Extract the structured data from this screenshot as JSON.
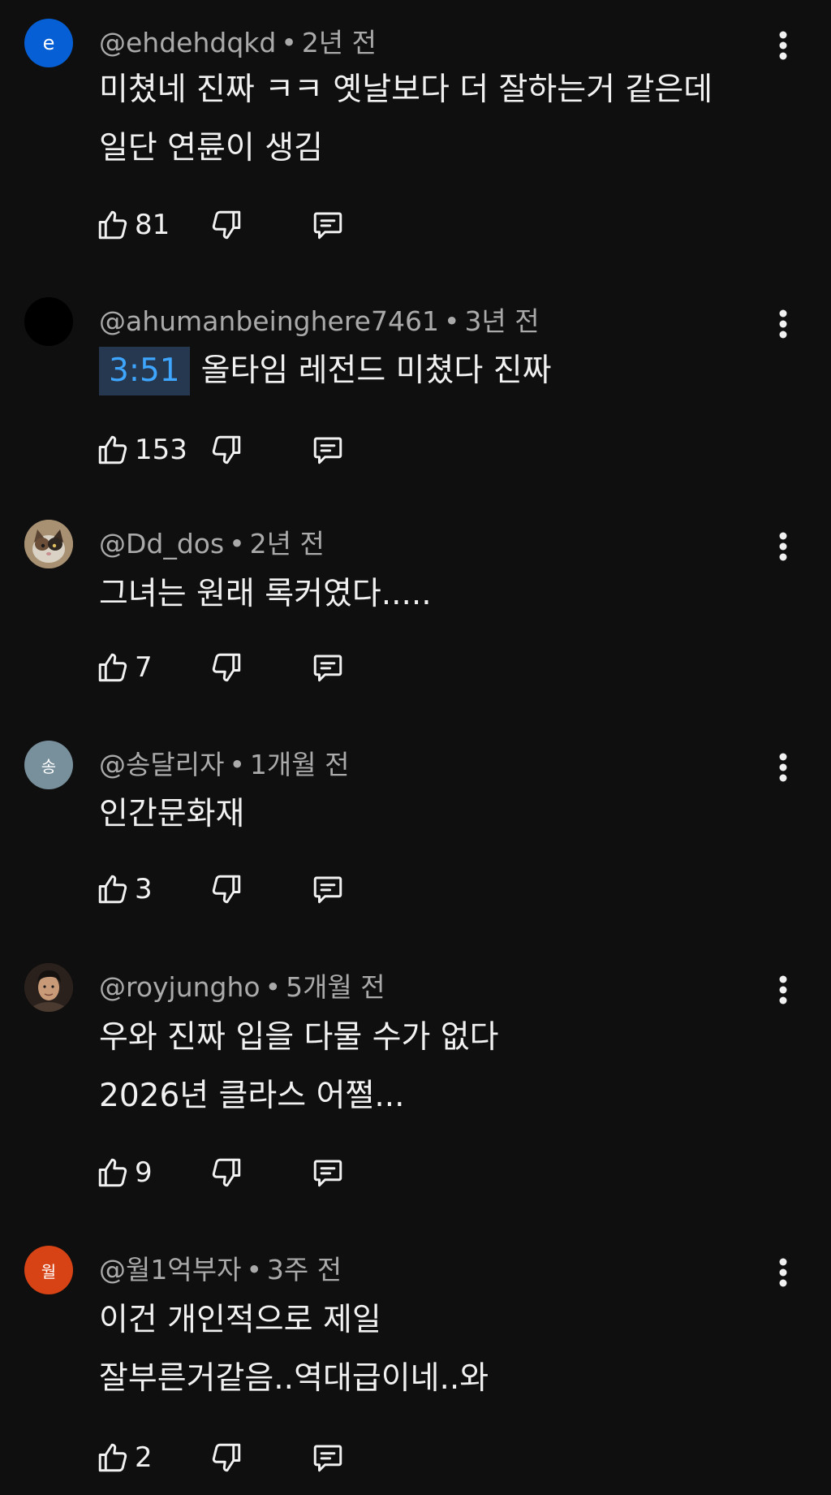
{
  "comments": [
    {
      "avatar": {
        "kind": "letter",
        "letter": "e",
        "color": "#065fd4"
      },
      "author": "@ehdehdqkd",
      "separator": "•",
      "time": "2년 전",
      "timestamp_link": "",
      "lines": [
        "미쳤네 진짜 ㅋㅋ 옛날보다 더 잘하는거 같은데",
        "일단 연륜이 생김"
      ],
      "like_count": "81"
    },
    {
      "avatar": {
        "kind": "plain",
        "color": "#000000"
      },
      "author": "@ahumanbeinghere7461",
      "separator": "•",
      "time": "3년 전",
      "timestamp_link": "3:51",
      "lines": [
        "올타임 레전드 미쳤다 진짜"
      ],
      "like_count": "153"
    },
    {
      "avatar": {
        "kind": "cat-photo",
        "color": "#8a7355"
      },
      "author": "@Dd_dos",
      "separator": "•",
      "time": "2년 전",
      "timestamp_link": "",
      "lines": [
        "그녀는 원래 록커였다....."
      ],
      "like_count": "7"
    },
    {
      "avatar": {
        "kind": "letter",
        "letter": "송",
        "color": "#78909c"
      },
      "author": "@송달리자",
      "separator": "•",
      "time": "1개월 전",
      "timestamp_link": "",
      "lines": [
        "인간문화재"
      ],
      "like_count": "3"
    },
    {
      "avatar": {
        "kind": "person-photo",
        "color": "#3a2a20"
      },
      "author": "@royjungho",
      "separator": "•",
      "time": "5개월 전",
      "timestamp_link": "",
      "lines": [
        "우와 진짜 입을 다물 수가 없다",
        "2026년 클라스 어쩔..."
      ],
      "like_count": "9"
    },
    {
      "avatar": {
        "kind": "letter",
        "letter": "월",
        "color": "#d84315"
      },
      "author": "@월1억부자",
      "separator": "•",
      "time": "3주 전",
      "timestamp_link": "",
      "lines": [
        "이건 개인적으로 제일",
        "잘부른거같음..역대급이네..와"
      ],
      "like_count": "2"
    }
  ],
  "icons": {
    "like": "thumb-up-icon",
    "dislike": "thumb-down-icon",
    "reply": "comment-reply-icon",
    "menu": "more-vert-icon"
  }
}
